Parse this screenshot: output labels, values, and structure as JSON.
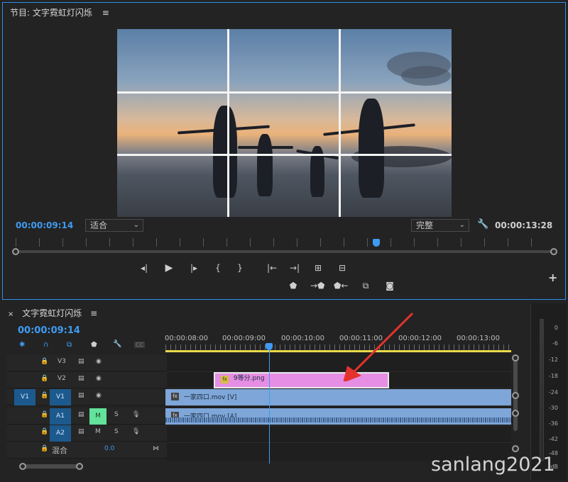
{
  "program_monitor": {
    "title": "节目: 文字霓虹灯闪烁",
    "menu_icon": "hamburger-icon",
    "current_timecode": "00:00:09:14",
    "fit_dropdown": "适合",
    "resolution_dropdown": "完整",
    "settings_icon": "wrench-icon",
    "duration_timecode": "00:00:13:28",
    "playhead_fraction": 0.67,
    "controls_row1": [
      "◀|",
      "▶",
      "|▶",
      "{",
      "}",
      "|◀",
      "▶|",
      "⇤",
      "⇥"
    ],
    "controls_row2": [
      "marker-icon",
      "insert-icon",
      "overwrite-icon",
      "export-frame-icon",
      "camera-icon"
    ],
    "add_button": "+"
  },
  "timeline": {
    "close_icon": "×",
    "title": "文字霓虹灯闪烁",
    "menu_icon": "≡",
    "current_timecode": "00:00:09:14",
    "ruler_labels": [
      "00:00:08:00",
      "00:00:09:00",
      "00:00:10:00",
      "00:00:11:00",
      "00:00:12:00",
      "00:00:13:00"
    ],
    "playhead_fraction": 0.3,
    "tracks": [
      {
        "lock": "🔒",
        "name": "V3",
        "icons": [
          "film-icon",
          "eye-icon"
        ]
      },
      {
        "lock": "🔒",
        "name": "V2",
        "icons": [
          "film-icon",
          "eye-icon"
        ]
      },
      {
        "source": "V1",
        "lock": "🔒",
        "name": "V1",
        "icons": [
          "film-icon",
          "eye-icon"
        ]
      },
      {
        "source": "A1",
        "lock": "🔒",
        "name": "A1",
        "m": "M",
        "s": "S"
      },
      {
        "lock": "🔒",
        "name": "A2",
        "m": "M",
        "s": "S"
      }
    ],
    "mix_label": "混合",
    "mix_value": "0.0",
    "clips": {
      "v2_png": "9等分.png",
      "v1_video": "一家四口.mov [V]",
      "a1_audio": "一家四口.mov [A]"
    },
    "tool_icons": [
      "snap-icon",
      "magnet-icon",
      "linked-icon",
      "marker-icon",
      "wrench-icon",
      "captions-icon"
    ],
    "captions_label": "CC"
  },
  "audio_meter": {
    "db_labels": [
      "0",
      "-6",
      "-12",
      "-18",
      "-24",
      "-30",
      "-36",
      "-42",
      "-48",
      "dB"
    ]
  },
  "watermark": "sanlang2021",
  "colors": {
    "accent": "#2d8ceb",
    "timecode": "#3f9bf2",
    "video_clip": "#7ea6d8",
    "png_clip": "#e58ee3",
    "arrow": "#e5322d",
    "mute_active": "#62e29a"
  }
}
